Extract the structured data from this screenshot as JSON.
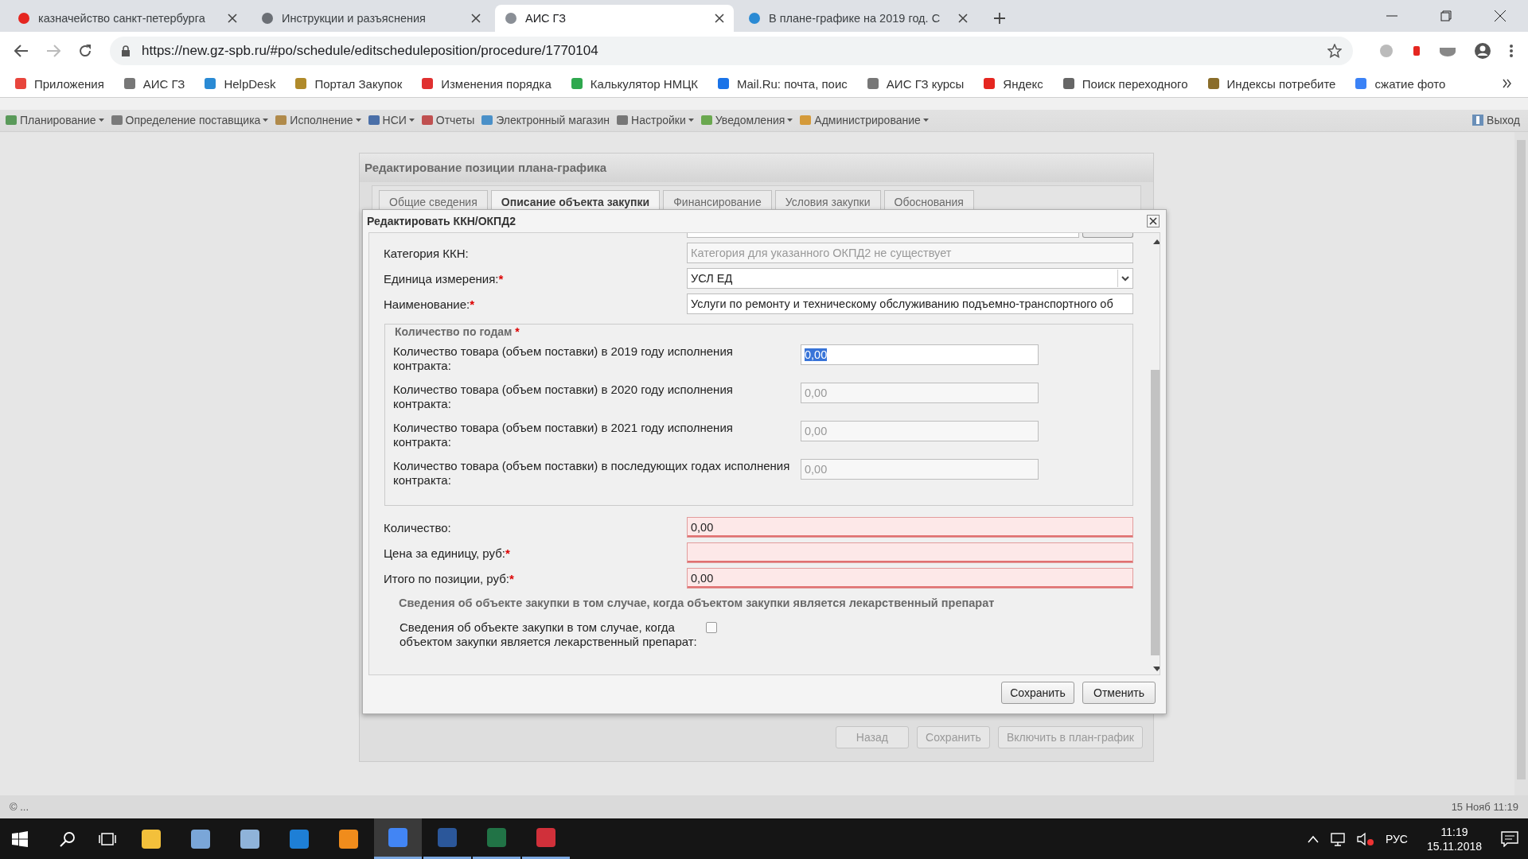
{
  "browser": {
    "tabs": [
      {
        "title": "казначейство санкт-петербурга",
        "selected": false
      },
      {
        "title": "Инструкции и разъяснения",
        "selected": false
      },
      {
        "title": "АИС ГЗ",
        "selected": true
      },
      {
        "title": "В плане-графике на 2019 год. С",
        "selected": false
      }
    ],
    "url": "https://new.gz-spb.ru/#po/schedule/editscheduleposition/procedure/1770104",
    "bookmarks": [
      "Приложения",
      "АИС ГЗ",
      "HelpDesk",
      "Портал Закупок",
      "Изменения порядка",
      "Калькулятор НМЦК",
      "Mail.Ru: почта, поис",
      "АИС ГЗ курсы",
      "Яндекс",
      "Поиск переходного",
      "Индексы потребите",
      "сжатие фото"
    ]
  },
  "menu": [
    {
      "label": "Планирование",
      "dropdown": true
    },
    {
      "label": "Определение поставщика",
      "dropdown": true
    },
    {
      "label": "Исполнение",
      "dropdown": true
    },
    {
      "label": "НСИ",
      "dropdown": true
    },
    {
      "label": "Отчеты",
      "dropdown": false
    },
    {
      "label": "Электронный магазин",
      "dropdown": false
    },
    {
      "label": "Настройки",
      "dropdown": true
    },
    {
      "label": "Уведомления",
      "dropdown": true
    },
    {
      "label": "Администрирование",
      "dropdown": true
    }
  ],
  "logout": "Выход",
  "panel": {
    "title": "Редактирование позиции плана-графика",
    "tabs": [
      {
        "label": "Общие сведения",
        "selected": false
      },
      {
        "label": "Описание объекта закупки",
        "selected": true
      },
      {
        "label": "Финансирование",
        "selected": false
      },
      {
        "label": "Условия закупки",
        "selected": false
      },
      {
        "label": "Обоснования",
        "selected": false
      }
    ],
    "buttons": [
      {
        "label": "Назад",
        "disabled": true
      },
      {
        "label": "Сохранить",
        "disabled": true
      },
      {
        "label": "Включить в план-график",
        "disabled": true
      }
    ]
  },
  "dialog": {
    "title": "Редактировать ККН/ОКПД2",
    "fields": [
      {
        "label": "Категория ККН:",
        "kind": "text",
        "value": "Категория для указанного ОКПД2 не существует",
        "readonly": true,
        "invalid": false
      },
      {
        "label": "Единица измерения:",
        "mark": "*",
        "kind": "select",
        "value": "УСЛ ЕД",
        "readonly": false,
        "invalid": false
      },
      {
        "label": "Наименование:",
        "mark": "*",
        "kind": "text",
        "value": "Услуги по ремонту и техническому обслуживанию подъемно-транспортного об",
        "readonly": false,
        "invalid": false
      }
    ],
    "years": {
      "legend": "Количество по годам",
      "mark": "*",
      "rows": [
        {
          "label": "Количество товара (объем поставки) в 2019 году исполнения контракта:",
          "value": "0,00",
          "selected": true,
          "disabled": false
        },
        {
          "label": "Количество товара (объем поставки) в 2020 году исполнения контракта:",
          "value": "0,00",
          "selected": false,
          "disabled": true
        },
        {
          "label": "Количество товара (объем поставки) в 2021 году исполнения контракта:",
          "value": "0,00",
          "selected": false,
          "disabled": true
        },
        {
          "label": "Количество товара (объем поставки) в последующих годах исполнения контракта:",
          "value": "0,00",
          "selected": false,
          "disabled": true
        }
      ]
    },
    "totals": [
      {
        "label": "Количество:",
        "value": "0,00",
        "readonly": false,
        "invalid": true
      },
      {
        "label": "Цена за единицу, руб:",
        "mark": "*",
        "readonly": false,
        "invalid": true
      },
      {
        "label": "Итого по позиции, руб:",
        "mark": "*",
        "value": "0,00",
        "readonly": false,
        "invalid": true
      }
    ],
    "section_title": "Сведения об объекте закупки в том случае, когда объектом закупки является лекарственный препарат",
    "checkbox": {
      "label": "Сведения об объекте закупки в том случае, когда объектом закупки является лекарственный препарат:",
      "checked": false
    },
    "buttons": [
      "Сохранить",
      "Отменить"
    ]
  },
  "status_bar": {
    "left": "© ...",
    "right": "15 Нояб 11:19"
  },
  "taskbar": {
    "apps": [
      {
        "active": false,
        "running": false
      },
      {
        "active": false,
        "running": false
      },
      {
        "active": false,
        "running": false
      },
      {
        "active": false,
        "running": false
      },
      {
        "active": false,
        "running": false
      },
      {
        "active": true,
        "running": true
      },
      {
        "active": false,
        "running": true
      },
      {
        "active": false,
        "running": true
      },
      {
        "active": false,
        "running": true
      }
    ],
    "lang": "РУС",
    "time": "11:19",
    "date": "15.11.2018"
  }
}
